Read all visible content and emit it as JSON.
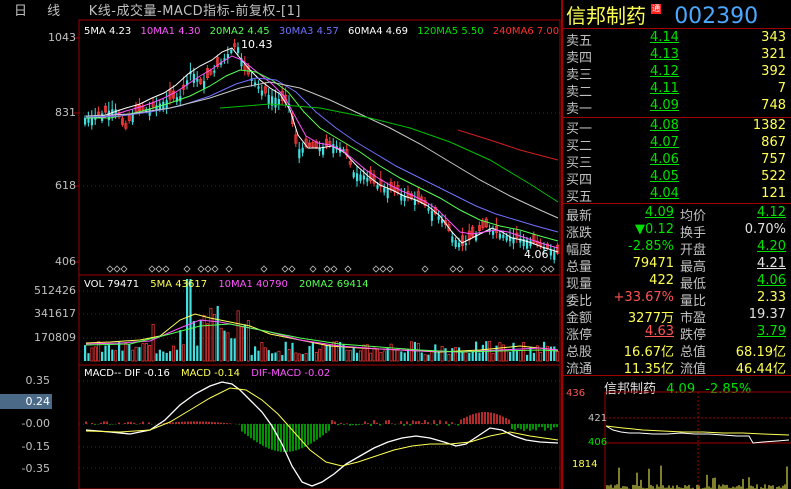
{
  "title": {
    "period": "日 线",
    "desc": "K线-成交量-MACD指标-前复权-[1]"
  },
  "kline": {
    "legend": [
      {
        "label": "5MA 4.23",
        "color": "#ffffff"
      },
      {
        "label": "10MA1 4.30",
        "color": "#ff54ff"
      },
      {
        "label": "20MA2 4.45",
        "color": "#54ff54"
      },
      {
        "label": "30MA3 4.57",
        "color": "#7070ff"
      },
      {
        "label": "60MA4 4.69",
        "color": "#ffffff"
      },
      {
        "label": "120MA5 5.50",
        "color": "#00e000"
      },
      {
        "label": "240MA6 7.00",
        "color": "#ff3030"
      }
    ],
    "yticks": [
      "1043",
      "831",
      "618",
      "406"
    ],
    "high_label": "10.43",
    "low_label": "4.06"
  },
  "volume": {
    "legend": [
      {
        "label": "VOL 79471",
        "color": "#ffffff"
      },
      {
        "label": "5MA 43617",
        "color": "#ffff54"
      },
      {
        "label": "10MA1 40790",
        "color": "#ff54ff"
      },
      {
        "label": "20MA2 69414",
        "color": "#54ff54"
      }
    ],
    "yticks": [
      "512426",
      "341617",
      "170809"
    ]
  },
  "macd": {
    "legend": [
      {
        "label": "MACD-- DIF -0.16",
        "color": "#ffffff"
      },
      {
        "label": "MACD -0.14",
        "color": "#ffff54"
      },
      {
        "label": "DIF-MACD -0.02",
        "color": "#ff54ff"
      }
    ],
    "yticks": [
      "0.35",
      "0.24",
      "-0.00",
      "-0.15",
      "-0.35"
    ],
    "highlight_tick": "0.24"
  },
  "stock": {
    "name": "信邦制药",
    "badge": "通",
    "code": "002390"
  },
  "order_book": {
    "asks": [
      {
        "label": "卖五",
        "price": "4.14",
        "vol": "343"
      },
      {
        "label": "卖四",
        "price": "4.13",
        "vol": "321"
      },
      {
        "label": "卖三",
        "price": "4.12",
        "vol": "392"
      },
      {
        "label": "卖二",
        "price": "4.11",
        "vol": "7"
      },
      {
        "label": "卖一",
        "price": "4.09",
        "vol": "748"
      }
    ],
    "bids": [
      {
        "label": "买一",
        "price": "4.08",
        "vol": "1382"
      },
      {
        "label": "买二",
        "price": "4.07",
        "vol": "867"
      },
      {
        "label": "买三",
        "price": "4.06",
        "vol": "757"
      },
      {
        "label": "买四",
        "price": "4.05",
        "vol": "522"
      },
      {
        "label": "买五",
        "price": "4.04",
        "vol": "121"
      }
    ]
  },
  "stats": [
    {
      "l1": "最新",
      "v1": "4.09",
      "c1": "v-green price",
      "l2": "均价",
      "v2": "4.12",
      "c2": "v-green price"
    },
    {
      "l1": "涨跌",
      "v1": "▼0.12",
      "c1": "v-green",
      "l2": "换手",
      "v2": "0.70%",
      "c2": "v-wht"
    },
    {
      "l1": "幅度",
      "v1": "-2.85%",
      "c1": "v-green",
      "l2": "开盘",
      "v2": "4.20",
      "c2": "v-green price"
    },
    {
      "l1": "总量",
      "v1": "79471",
      "c1": "v-yel",
      "l2": "最高",
      "v2": "4.21",
      "c2": "v-wht price"
    },
    {
      "l1": "现量",
      "v1": "422",
      "c1": "v-yel",
      "l2": "最低",
      "v2": "4.06",
      "c2": "v-green price"
    },
    {
      "l1": "委比",
      "v1": "+33.67%",
      "c1": "v-red",
      "l2": "量比",
      "v2": "2.33",
      "c2": "v-yel"
    },
    {
      "l1": "金额",
      "v1": "3277万",
      "c1": "v-yel",
      "l2": "市盈",
      "v2": "19.37",
      "c2": "v-wht"
    },
    {
      "l1": "涨停",
      "v1": "4.63",
      "c1": "v-red price",
      "l2": "跌停",
      "v2": "3.79",
      "c2": "v-green price"
    },
    {
      "l1": "总股",
      "v1": "16.67亿",
      "c1": "v-yel",
      "l2": "总值",
      "v2": "68.19亿",
      "c2": "v-yel"
    },
    {
      "l1": "流通",
      "v1": "11.35亿",
      "c1": "v-yel",
      "l2": "流值",
      "v2": "46.44亿",
      "c2": "v-yel"
    }
  ],
  "mini": {
    "name": "信邦制药",
    "price": "4.09",
    "change": "-2.85%",
    "yticks": {
      "high": "436",
      "mid": "421",
      "low": "406",
      "vol": "1814"
    }
  }
}
